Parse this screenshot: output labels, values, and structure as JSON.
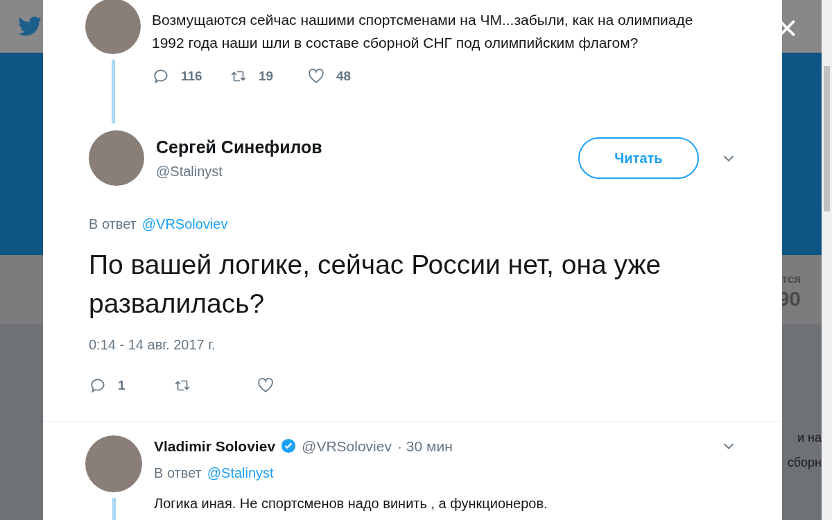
{
  "background": {
    "fragments": [
      "тся",
      "90",
      "и на",
      "сборн"
    ]
  },
  "close": {
    "label": "×"
  },
  "thread": [
    {
      "kind": "context",
      "text": "Возмущаются сейчас нашими спортсменами на ЧМ...забыли, как на олимпиаде 1992 года наши  шли в составе сборной СНГ под олимпийским флагом?",
      "actions": {
        "replies": "116",
        "retweets": "19",
        "likes": "48"
      }
    },
    {
      "kind": "main",
      "name": "Сергей Синефилов",
      "handle": "@Stalinyst",
      "follow": "Читать",
      "reply_prefix": "В ответ",
      "reply_to": "@VRSoloviev",
      "text": "По вашей логике, сейчас России нет, она уже развалилась?",
      "date": "0:14 - 14 авг. 2017 г.",
      "actions": {
        "replies": "1"
      }
    },
    {
      "kind": "reply",
      "name": "Vladimir Soloviev",
      "verified": true,
      "handle": "@VRSoloviev",
      "time": "· 30 мин",
      "reply_prefix": "В ответ",
      "reply_to": "@Stalinyst",
      "text": "Логика иная. Не спортсменов надо винить , а функционеров."
    }
  ]
}
